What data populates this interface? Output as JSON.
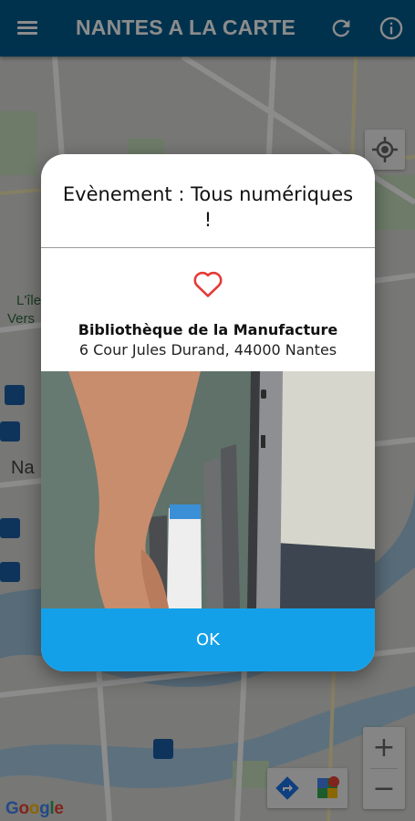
{
  "app": {
    "title": "NANTES A LA CARTE",
    "bar_color": "#005b8e",
    "icons": [
      "menu-icon",
      "refresh-icon",
      "info-icon"
    ]
  },
  "map": {
    "attribution": "Google",
    "labels": [
      "L'île",
      "Vers",
      "Na"
    ],
    "controls": {
      "zoom_in": "+",
      "zoom_out": "−",
      "icons": [
        "my-location-icon",
        "directions-icon",
        "google-maps-icon"
      ]
    }
  },
  "dialog": {
    "title": "Evènement : Tous numériques !",
    "favorite_icon": "heart-outline-icon",
    "favorite_color": "#e53935",
    "place_name": "Bibliothèque de la Manufacture",
    "address": "6 Cour Jules Durand, 44000 Nantes",
    "image_alt": "photo",
    "ok_label": "OK",
    "ok_color": "#13a0e9"
  }
}
